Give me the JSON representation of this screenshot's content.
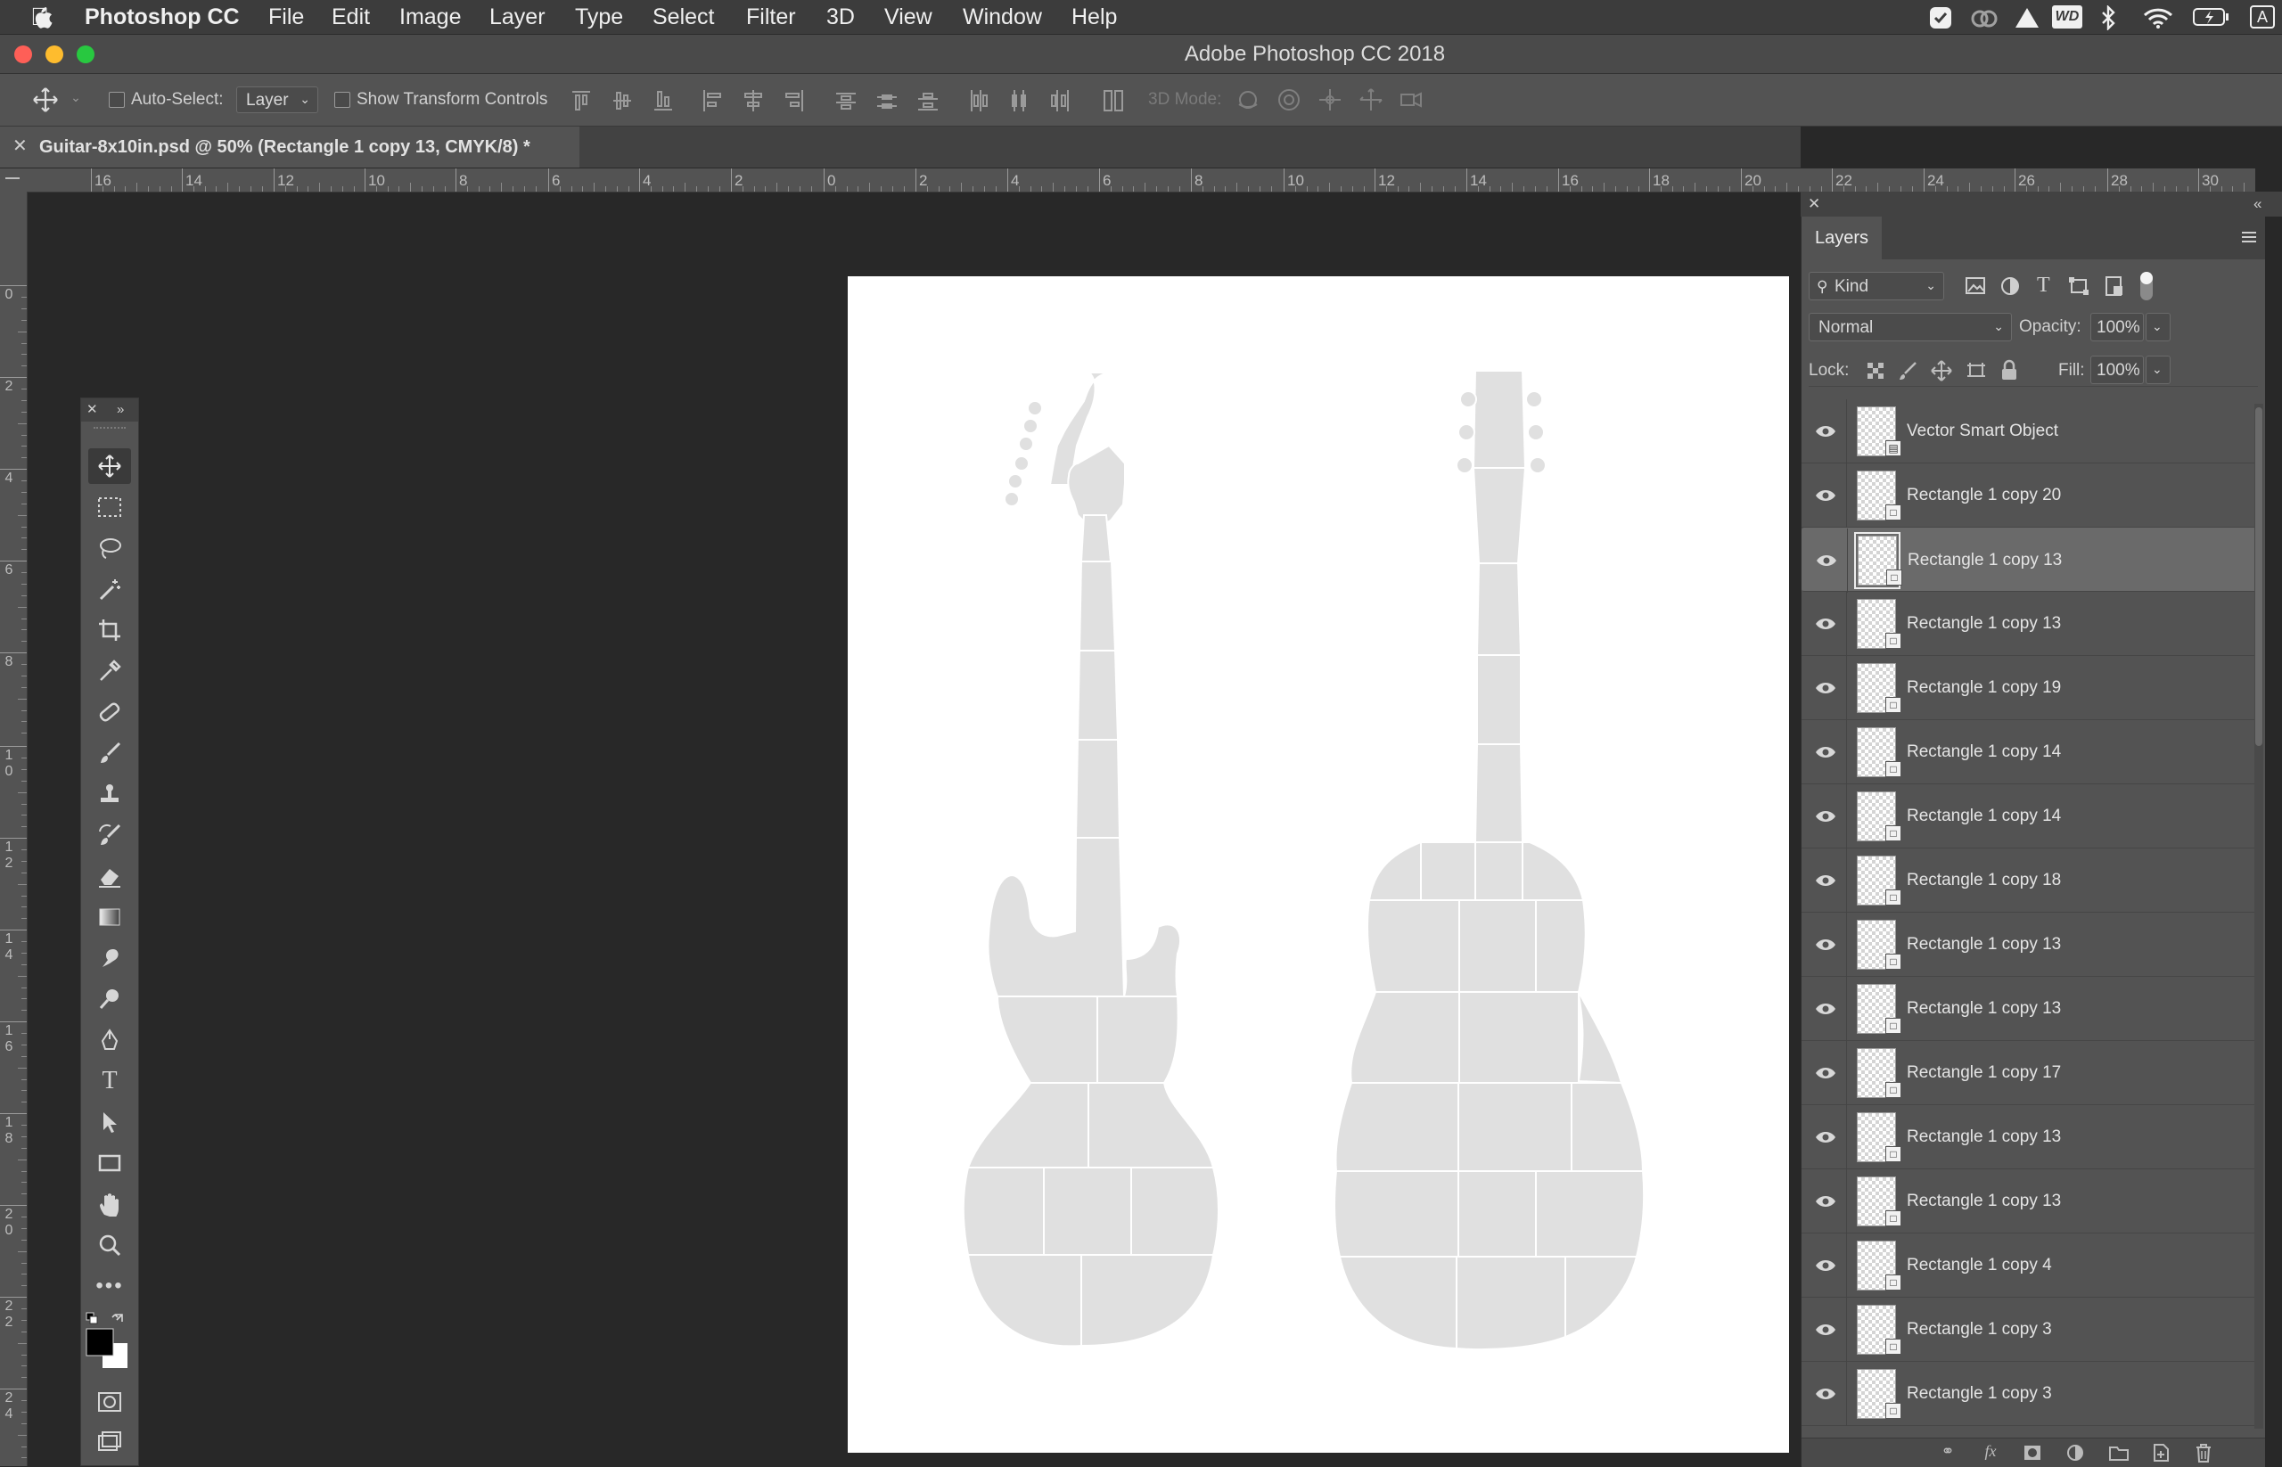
{
  "menubar": {
    "apple_icon": "apple-logo",
    "app_name": "Photoshop CC",
    "items": [
      "File",
      "Edit",
      "Image",
      "Layer",
      "Type",
      "Select",
      "Filter",
      "3D",
      "View",
      "Window",
      "Help"
    ],
    "tray_icons": [
      "shield-check-icon",
      "creative-cloud-icon",
      "drive-icon",
      "wd-icon",
      "bluetooth-icon",
      "wifi-icon",
      "battery-icon",
      "user-icon"
    ],
    "wd_label": "WD",
    "user_label": "A"
  },
  "window": {
    "title": "Adobe Photoshop CC 2018",
    "colors": {
      "close": "#fe5f57",
      "minimize": "#febc2e",
      "maximize": "#28c840"
    }
  },
  "options": {
    "auto_select_label": "Auto-Select:",
    "auto_select_value": "Layer",
    "show_transform_label": "Show Transform Controls",
    "mode_3d_label": "3D Mode:"
  },
  "document": {
    "tab_title": "Guitar-8x10in.psd @ 50% (Rectangle 1 copy 13, CMYK/8) *"
  },
  "rulers": {
    "horizontal": [
      "16",
      "14",
      "12",
      "10",
      "8",
      "6",
      "4",
      "2",
      "0",
      "2",
      "4",
      "6",
      "8",
      "10",
      "12",
      "14",
      "16",
      "18",
      "20",
      "22",
      "24",
      "26",
      "28",
      "30"
    ],
    "vertical": [
      "0",
      "2",
      "4",
      "6",
      "8",
      "10",
      "12",
      "14",
      "16",
      "18",
      "20",
      "22",
      "24"
    ]
  },
  "tools": [
    "move-tool",
    "marquee-tool",
    "lasso-tool",
    "magic-wand-tool",
    "crop-tool",
    "eyedropper-tool",
    "healing-brush-tool",
    "brush-tool",
    "clone-stamp-tool",
    "history-brush-tool",
    "eraser-tool",
    "gradient-tool",
    "smudge-tool",
    "dodge-tool",
    "pen-tool",
    "type-tool",
    "path-selection-tool",
    "rectangle-tool",
    "hand-tool",
    "zoom-tool",
    "more-tools"
  ],
  "layers_panel": {
    "tab_label": "Layers",
    "filter_kind": "Kind",
    "blend_mode": "Normal",
    "opacity_label": "Opacity:",
    "opacity_value": "100%",
    "lock_label": "Lock:",
    "fill_label": "Fill:",
    "fill_value": "100%",
    "layers": [
      {
        "name": "Vector Smart Object",
        "selected": false,
        "type": "smart-object"
      },
      {
        "name": "Rectangle 1 copy 20",
        "selected": false,
        "type": "shape"
      },
      {
        "name": "Rectangle 1 copy 13",
        "selected": true,
        "type": "shape"
      },
      {
        "name": "Rectangle 1 copy 13",
        "selected": false,
        "type": "shape"
      },
      {
        "name": "Rectangle 1 copy 19",
        "selected": false,
        "type": "shape"
      },
      {
        "name": "Rectangle 1 copy 14",
        "selected": false,
        "type": "shape"
      },
      {
        "name": "Rectangle 1 copy 14",
        "selected": false,
        "type": "shape"
      },
      {
        "name": "Rectangle 1 copy 18",
        "selected": false,
        "type": "shape"
      },
      {
        "name": "Rectangle 1 copy 13",
        "selected": false,
        "type": "shape"
      },
      {
        "name": "Rectangle 1 copy 13",
        "selected": false,
        "type": "shape"
      },
      {
        "name": "Rectangle 1 copy 17",
        "selected": false,
        "type": "shape"
      },
      {
        "name": "Rectangle 1 copy 13",
        "selected": false,
        "type": "shape"
      },
      {
        "name": "Rectangle 1 copy 13",
        "selected": false,
        "type": "shape"
      },
      {
        "name": "Rectangle 1 copy 4",
        "selected": false,
        "type": "shape"
      },
      {
        "name": "Rectangle 1 copy 3",
        "selected": false,
        "type": "shape"
      },
      {
        "name": "Rectangle 1 copy 3",
        "selected": false,
        "type": "shape"
      }
    ]
  },
  "canvas": {
    "artboard_color": "#ffffff",
    "shape_color": "#e0e0e0"
  }
}
